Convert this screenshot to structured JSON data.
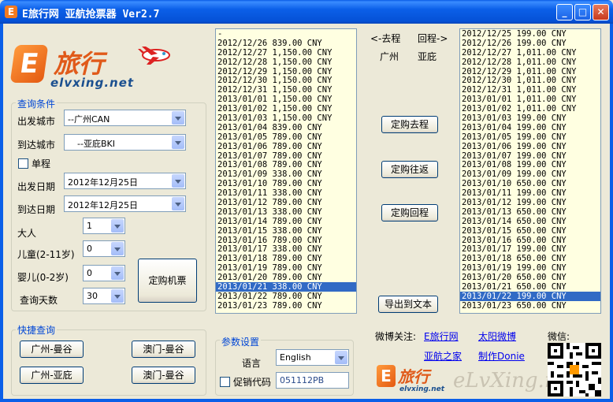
{
  "window": {
    "title": "E旅行网 亚航抢票器 Ver2.7",
    "icon_letter": "E",
    "minimize_glyph": "_",
    "maximize_glyph": "□",
    "close_glyph": "✕"
  },
  "logo": {
    "letter": "E",
    "cn": "旅行",
    "en": "elvxing.net"
  },
  "query": {
    "group_label": "查询条件",
    "from_label": "出发城市",
    "from_value": "--广州CAN",
    "to_label": "到达城市",
    "to_value": "--亚庇BKI",
    "oneway_label": "单程",
    "oneway_checked": false,
    "depart_label": "出发日期",
    "depart_value": "2012年12月25日",
    "arrive_label": "到达日期",
    "arrive_value": "2012年12月25日",
    "adult_label": "大人",
    "adult_value": "1",
    "child_label": "儿童(2-11岁)",
    "child_value": "0",
    "infant_label": "婴儿(0-2岁)",
    "infant_value": "0",
    "days_label": "查询天数",
    "days_value": "30",
    "book_button": "定购机票"
  },
  "quick": {
    "group_label": "快捷查询",
    "b1": "广州-曼谷",
    "b2": "澳门-曼谷",
    "b3": "广州-亚庇",
    "b4": "澳门-曼谷"
  },
  "params": {
    "group_label": "参数设置",
    "lang_label": "语言",
    "lang_value": "English",
    "promo_label": "促销代码",
    "promo_checked": false,
    "promo_value": "051112PB"
  },
  "middle": {
    "out_label": "<-去程",
    "ret_label": "回程->",
    "out_city": "广州",
    "ret_city": "亚庇",
    "book_out": "定购去程",
    "book_round": "定购往返",
    "book_return": "定购回程",
    "export": "导出到文本"
  },
  "outbound_list": [
    "-",
    "2012/12/26 839.00 CNY",
    "2012/12/27 1,150.00 CNY",
    "2012/12/28 1,150.00 CNY",
    "2012/12/29 1,150.00 CNY",
    "2012/12/30 1,150.00 CNY",
    "2012/12/31 1,150.00 CNY",
    "2013/01/01 1,150.00 CNY",
    "2013/01/02 1,150.00 CNY",
    "2013/01/03 1,150.00 CNY",
    "2013/01/04 839.00 CNY",
    "2013/01/05 789.00 CNY",
    "2013/01/06 789.00 CNY",
    "2013/01/07 789.00 CNY",
    "2013/01/08 789.00 CNY",
    "2013/01/09 338.00 CNY",
    "2013/01/10 789.00 CNY",
    "2013/01/11 338.00 CNY",
    "2013/01/12 789.00 CNY",
    "2013/01/13 338.00 CNY",
    "2013/01/14 789.00 CNY",
    "2013/01/15 338.00 CNY",
    "2013/01/16 789.00 CNY",
    "2013/01/17 338.00 CNY",
    "2013/01/18 789.00 CNY",
    "2013/01/19 789.00 CNY",
    "2013/01/20 789.00 CNY",
    "2013/01/21 338.00 CNY",
    "2013/01/22 789.00 CNY",
    "2013/01/23 789.00 CNY"
  ],
  "outbound_selected": 27,
  "return_list": [
    "2012/12/25 199.00 CNY",
    "2012/12/26 199.00 CNY",
    "2012/12/27 1,011.00 CNY",
    "2012/12/28 1,011.00 CNY",
    "2012/12/29 1,011.00 CNY",
    "2012/12/30 1,011.00 CNY",
    "2012/12/31 1,011.00 CNY",
    "2013/01/01 1,011.00 CNY",
    "2013/01/02 1,011.00 CNY",
    "2013/01/03 199.00 CNY",
    "2013/01/04 199.00 CNY",
    "2013/01/05 199.00 CNY",
    "2013/01/06 199.00 CNY",
    "2013/01/07 199.00 CNY",
    "2013/01/08 199.00 CNY",
    "2013/01/09 199.00 CNY",
    "2013/01/10 650.00 CNY",
    "2013/01/11 199.00 CNY",
    "2013/01/12 199.00 CNY",
    "2013/01/13 650.00 CNY",
    "2013/01/14 650.00 CNY",
    "2013/01/15 650.00 CNY",
    "2013/01/16 650.00 CNY",
    "2013/01/17 199.00 CNY",
    "2013/01/18 650.00 CNY",
    "2013/01/19 199.00 CNY",
    "2013/01/20 650.00 CNY",
    "2013/01/21 650.00 CNY",
    "2013/01/22 199.00 CNY",
    "2013/01/23 650.00 CNY"
  ],
  "return_selected": 28,
  "footer": {
    "weibo_label": "微博关注:",
    "link1": "E旅行网",
    "link2": "太阳微博",
    "link3": "亚航之家",
    "link4": "制作Donie",
    "wechat_label": "微信:",
    "small_logo_cn": "旅行",
    "small_logo_en": "elvxing.net",
    "watermark": "eLvXing.net"
  },
  "colors": {
    "title_bar": "#0b5fe8",
    "list_bg": "#ffffe1",
    "selection": "#316ac5",
    "group_label": "#0046d5"
  }
}
